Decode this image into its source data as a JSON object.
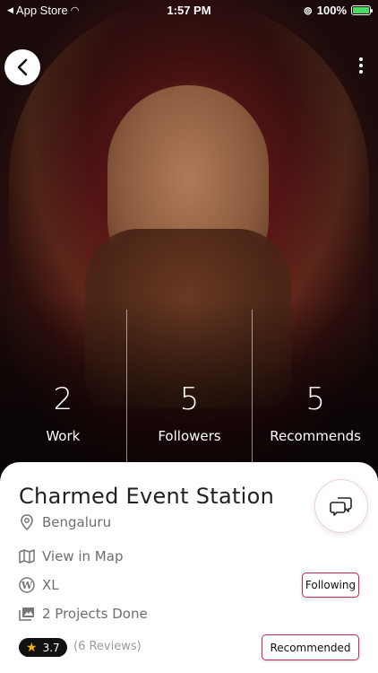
{
  "status_bar": {
    "back_app": "App Store",
    "time": "1:57 PM",
    "battery": "100%",
    "battery_level": 1.0
  },
  "profile": {
    "name": "Charmed Event Station",
    "location": "Bengaluru",
    "map_link": "View in Map",
    "website": "XL",
    "projects": "2 Projects Done",
    "rating": "3.7",
    "reviews": "(6 Reviews)"
  },
  "stats": [
    {
      "value": "2",
      "label": "Work"
    },
    {
      "value": "5",
      "label": "Followers"
    },
    {
      "value": "5",
      "label": "Recommends"
    }
  ],
  "actions": {
    "following": "Following",
    "recommended": "Recommended"
  },
  "colors": {
    "accent": "#c8294e",
    "battery": "#4cd964",
    "star": "#f5b301"
  }
}
